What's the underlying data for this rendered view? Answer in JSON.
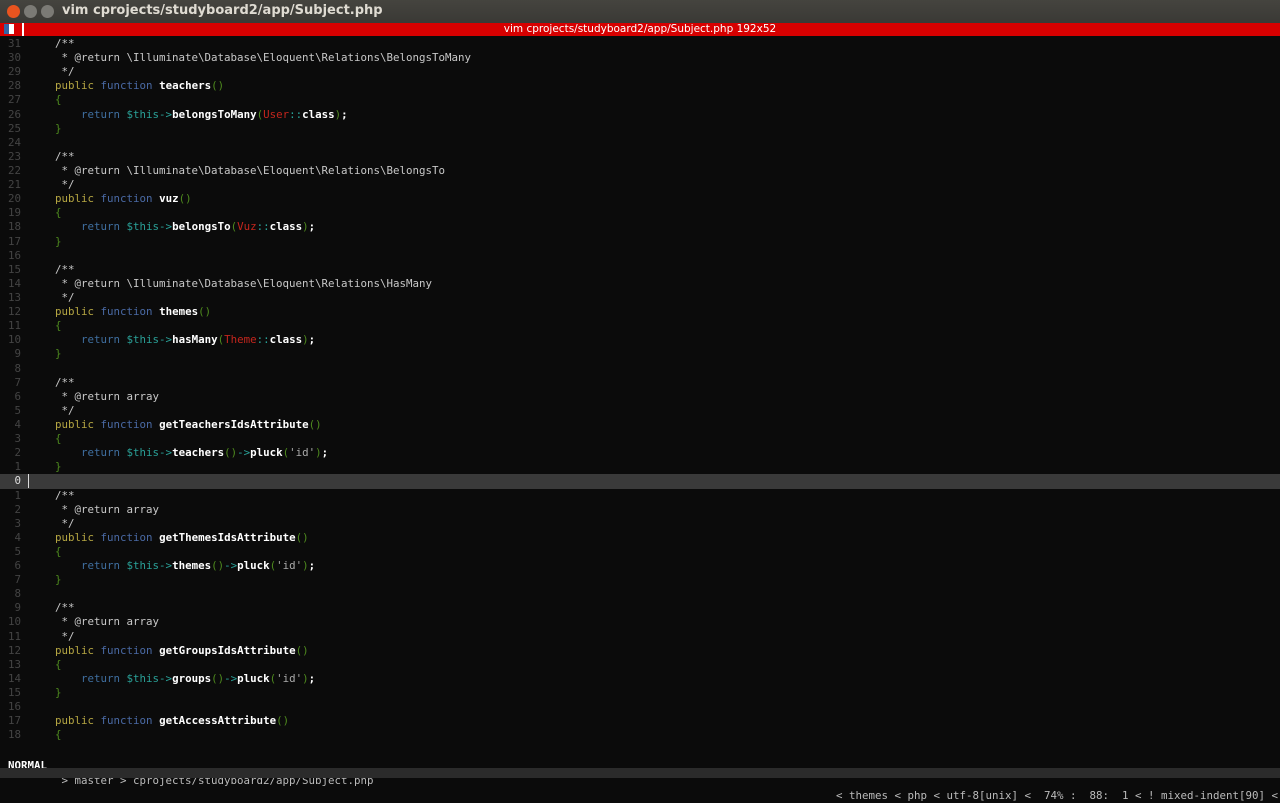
{
  "window": {
    "title": "vim cprojects/studyboard2/app/Subject.php"
  },
  "tmux": {
    "title": "vim cprojects/studyboard2/app/Subject.php 192x52"
  },
  "lines": [
    {
      "n": "31",
      "t": [
        [
          "cm",
          "    /**"
        ]
      ]
    },
    {
      "n": "30",
      "t": [
        [
          "cm",
          "     * @return \\Illuminate\\Database\\Eloquent\\Relations\\BelongsToMany"
        ]
      ]
    },
    {
      "n": "29",
      "t": [
        [
          "cm",
          "     */"
        ]
      ]
    },
    {
      "n": "28",
      "t": [
        [
          "pl",
          "    "
        ],
        [
          "kw",
          "public"
        ],
        [
          "pl",
          " "
        ],
        [
          "fn",
          "function"
        ],
        [
          "pl",
          " "
        ],
        [
          "nm",
          "teachers"
        ],
        [
          "pa",
          "()"
        ]
      ]
    },
    {
      "n": "27",
      "t": [
        [
          "pa",
          "    {"
        ]
      ]
    },
    {
      "n": "26",
      "t": [
        [
          "pl",
          "        "
        ],
        [
          "ret",
          "return"
        ],
        [
          "pl",
          " "
        ],
        [
          "var",
          "$this->"
        ],
        [
          "nm",
          "belongsToMany"
        ],
        [
          "pa",
          "("
        ],
        [
          "cls",
          "User"
        ],
        [
          "var",
          "::"
        ],
        [
          "nm",
          "class"
        ],
        [
          "pa",
          ")"
        ],
        [
          "nm",
          ";"
        ]
      ]
    },
    {
      "n": "25",
      "t": [
        [
          "pa",
          "    }"
        ]
      ]
    },
    {
      "n": "24",
      "t": []
    },
    {
      "n": "23",
      "t": [
        [
          "cm",
          "    /**"
        ]
      ]
    },
    {
      "n": "22",
      "t": [
        [
          "cm",
          "     * @return \\Illuminate\\Database\\Eloquent\\Relations\\BelongsTo"
        ]
      ]
    },
    {
      "n": "21",
      "t": [
        [
          "cm",
          "     */"
        ]
      ]
    },
    {
      "n": "20",
      "t": [
        [
          "pl",
          "    "
        ],
        [
          "kw",
          "public"
        ],
        [
          "pl",
          " "
        ],
        [
          "fn",
          "function"
        ],
        [
          "pl",
          " "
        ],
        [
          "nm",
          "vuz"
        ],
        [
          "pa",
          "()"
        ]
      ]
    },
    {
      "n": "19",
      "t": [
        [
          "pa",
          "    {"
        ]
      ]
    },
    {
      "n": "18",
      "t": [
        [
          "pl",
          "        "
        ],
        [
          "ret",
          "return"
        ],
        [
          "pl",
          " "
        ],
        [
          "var",
          "$this->"
        ],
        [
          "nm",
          "belongsTo"
        ],
        [
          "pa",
          "("
        ],
        [
          "cls",
          "Vuz"
        ],
        [
          "var",
          "::"
        ],
        [
          "nm",
          "class"
        ],
        [
          "pa",
          ")"
        ],
        [
          "nm",
          ";"
        ]
      ]
    },
    {
      "n": "17",
      "t": [
        [
          "pa",
          "    }"
        ]
      ]
    },
    {
      "n": "16",
      "t": []
    },
    {
      "n": "15",
      "t": [
        [
          "cm",
          "    /**"
        ]
      ]
    },
    {
      "n": "14",
      "t": [
        [
          "cm",
          "     * @return \\Illuminate\\Database\\Eloquent\\Relations\\HasMany"
        ]
      ]
    },
    {
      "n": "13",
      "t": [
        [
          "cm",
          "     */"
        ]
      ]
    },
    {
      "n": "12",
      "t": [
        [
          "pl",
          "    "
        ],
        [
          "kw",
          "public"
        ],
        [
          "pl",
          " "
        ],
        [
          "fn",
          "function"
        ],
        [
          "pl",
          " "
        ],
        [
          "nm",
          "themes"
        ],
        [
          "pa",
          "()"
        ]
      ]
    },
    {
      "n": "11",
      "t": [
        [
          "pa",
          "    {"
        ]
      ]
    },
    {
      "n": "10",
      "t": [
        [
          "pl",
          "        "
        ],
        [
          "ret",
          "return"
        ],
        [
          "pl",
          " "
        ],
        [
          "var",
          "$this->"
        ],
        [
          "nm",
          "hasMany"
        ],
        [
          "pa",
          "("
        ],
        [
          "cls",
          "Theme"
        ],
        [
          "var",
          "::"
        ],
        [
          "nm",
          "class"
        ],
        [
          "pa",
          ")"
        ],
        [
          "nm",
          ";"
        ]
      ]
    },
    {
      "n": "9",
      "t": [
        [
          "pa",
          "    }"
        ]
      ]
    },
    {
      "n": "8",
      "t": []
    },
    {
      "n": "7",
      "t": [
        [
          "cm",
          "    /**"
        ]
      ]
    },
    {
      "n": "6",
      "t": [
        [
          "cm",
          "     * @return array"
        ]
      ]
    },
    {
      "n": "5",
      "t": [
        [
          "cm",
          "     */"
        ]
      ]
    },
    {
      "n": "4",
      "t": [
        [
          "pl",
          "    "
        ],
        [
          "kw",
          "public"
        ],
        [
          "pl",
          " "
        ],
        [
          "fn",
          "function"
        ],
        [
          "pl",
          " "
        ],
        [
          "nm",
          "getTeachersIdsAttribute"
        ],
        [
          "pa",
          "()"
        ]
      ]
    },
    {
      "n": "3",
      "t": [
        [
          "pa",
          "    {"
        ]
      ]
    },
    {
      "n": "2",
      "t": [
        [
          "pl",
          "        "
        ],
        [
          "ret",
          "return"
        ],
        [
          "pl",
          " "
        ],
        [
          "var",
          "$this->"
        ],
        [
          "nm",
          "teachers"
        ],
        [
          "pa",
          "()"
        ],
        [
          "var",
          "->"
        ],
        [
          "nm",
          "pluck"
        ],
        [
          "pa",
          "("
        ],
        [
          "str",
          "'id'"
        ],
        [
          "pa",
          ")"
        ],
        [
          "nm",
          ";"
        ]
      ]
    },
    {
      "n": "1",
      "t": [
        [
          "pa",
          "    }"
        ]
      ]
    },
    {
      "n": "0",
      "t": [],
      "current": true
    },
    {
      "n": "1",
      "t": [
        [
          "cm",
          "    /**"
        ]
      ]
    },
    {
      "n": "2",
      "t": [
        [
          "cm",
          "     * @return array"
        ]
      ]
    },
    {
      "n": "3",
      "t": [
        [
          "cm",
          "     */"
        ]
      ]
    },
    {
      "n": "4",
      "t": [
        [
          "pl",
          "    "
        ],
        [
          "kw",
          "public"
        ],
        [
          "pl",
          " "
        ],
        [
          "fn",
          "function"
        ],
        [
          "pl",
          " "
        ],
        [
          "nm",
          "getThemesIdsAttribute"
        ],
        [
          "pa",
          "()"
        ]
      ]
    },
    {
      "n": "5",
      "t": [
        [
          "pa",
          "    {"
        ]
      ]
    },
    {
      "n": "6",
      "t": [
        [
          "pl",
          "        "
        ],
        [
          "ret",
          "return"
        ],
        [
          "pl",
          " "
        ],
        [
          "var",
          "$this->"
        ],
        [
          "nm",
          "themes"
        ],
        [
          "pa",
          "()"
        ],
        [
          "var",
          "->"
        ],
        [
          "nm",
          "pluck"
        ],
        [
          "pa",
          "("
        ],
        [
          "str",
          "'id'"
        ],
        [
          "pa",
          ")"
        ],
        [
          "nm",
          ";"
        ]
      ]
    },
    {
      "n": "7",
      "t": [
        [
          "pa",
          "    }"
        ]
      ]
    },
    {
      "n": "8",
      "t": []
    },
    {
      "n": "9",
      "t": [
        [
          "cm",
          "    /**"
        ]
      ]
    },
    {
      "n": "10",
      "t": [
        [
          "cm",
          "     * @return array"
        ]
      ]
    },
    {
      "n": "11",
      "t": [
        [
          "cm",
          "     */"
        ]
      ]
    },
    {
      "n": "12",
      "t": [
        [
          "pl",
          "    "
        ],
        [
          "kw",
          "public"
        ],
        [
          "pl",
          " "
        ],
        [
          "fn",
          "function"
        ],
        [
          "pl",
          " "
        ],
        [
          "nm",
          "getGroupsIdsAttribute"
        ],
        [
          "pa",
          "()"
        ]
      ]
    },
    {
      "n": "13",
      "t": [
        [
          "pa",
          "    {"
        ]
      ]
    },
    {
      "n": "14",
      "t": [
        [
          "pl",
          "        "
        ],
        [
          "ret",
          "return"
        ],
        [
          "pl",
          " "
        ],
        [
          "var",
          "$this->"
        ],
        [
          "nm",
          "groups"
        ],
        [
          "pa",
          "()"
        ],
        [
          "var",
          "->"
        ],
        [
          "nm",
          "pluck"
        ],
        [
          "pa",
          "("
        ],
        [
          "str",
          "'id'"
        ],
        [
          "pa",
          ")"
        ],
        [
          "nm",
          ";"
        ]
      ]
    },
    {
      "n": "15",
      "t": [
        [
          "pa",
          "    }"
        ]
      ]
    },
    {
      "n": "16",
      "t": []
    },
    {
      "n": "17",
      "t": [
        [
          "pl",
          "    "
        ],
        [
          "kw",
          "public"
        ],
        [
          "pl",
          " "
        ],
        [
          "fn",
          "function"
        ],
        [
          "pl",
          " "
        ],
        [
          "nm",
          "getAccessAttribute"
        ],
        [
          "pa",
          "()"
        ]
      ]
    },
    {
      "n": "18",
      "t": [
        [
          "pa",
          "    {"
        ]
      ]
    }
  ],
  "statusline": {
    "mode": "NORMAL",
    "left": " > master > cprojects/studyboard2/app/Subject.php",
    "right": "< themes < php < utf-8[unix] <  74% :  88:  1 < ! mixed-indent[90] <"
  }
}
